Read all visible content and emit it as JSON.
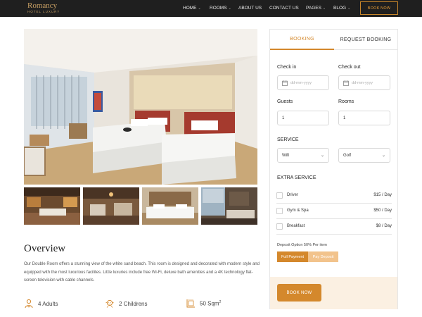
{
  "brand": {
    "name": "Romancy",
    "tagline": "HOTEL LUXURY"
  },
  "nav": {
    "items": [
      {
        "label": "HOME",
        "has_dropdown": true
      },
      {
        "label": "ROOMS",
        "has_dropdown": true
      },
      {
        "label": "ABOUT US",
        "has_dropdown": false
      },
      {
        "label": "CONTACT US",
        "has_dropdown": false
      },
      {
        "label": "PAGES",
        "has_dropdown": true
      },
      {
        "label": "BLOG",
        "has_dropdown": true
      }
    ],
    "book_now": "BOOK NOW"
  },
  "overview": {
    "title": "Overview",
    "text": "Our Double Room offers a stunning view of the white sand beach. This room is designed and decorated with modern style and equipped with the most luxurious facilites. Little luxuries include free Wi-Fi, deluxe bath amenities and a 4K technology flat-screen television with cable channels.",
    "features": [
      {
        "icon": "adults-icon",
        "label": "4 Adults"
      },
      {
        "icon": "childrens-icon",
        "label": "2 Childrens"
      },
      {
        "icon": "room-size-icon",
        "label": "50 Sqm",
        "sup": "2"
      }
    ]
  },
  "booking": {
    "tabs": [
      "BOOKING",
      "REQUEST BOOKING"
    ],
    "active_tab": 0,
    "check_in": {
      "label": "Check in",
      "placeholder": "dd-mm-yyyy"
    },
    "check_out": {
      "label": "Check out",
      "placeholder": "dd-mm-yyyy"
    },
    "guests": {
      "label": "Guests",
      "value": "1"
    },
    "rooms": {
      "label": "Rooms",
      "value": "1"
    },
    "service": {
      "label": "SERVICE",
      "options": [
        "Wifi",
        "Golf"
      ]
    },
    "extra_service": {
      "label": "EXTRA SERVICE",
      "items": [
        {
          "name": "Driver",
          "price": "$15 / Day"
        },
        {
          "name": "Gym & Spa",
          "price": "$50 / Day"
        },
        {
          "name": "Breakfast",
          "price": "$8 / Day"
        }
      ]
    },
    "deposit_label": "Deposit Option 50% Per item",
    "full_payment": "Full Payment",
    "pay_deposit": "Pay Deposit",
    "book_now": "BOOK NOW"
  },
  "colors": {
    "accent": "#d4882c",
    "header_bg": "#1f1f1f",
    "gold": "#c9a064",
    "deposit_light": "#f2c38c",
    "footer_tint": "#fbf0e2"
  }
}
